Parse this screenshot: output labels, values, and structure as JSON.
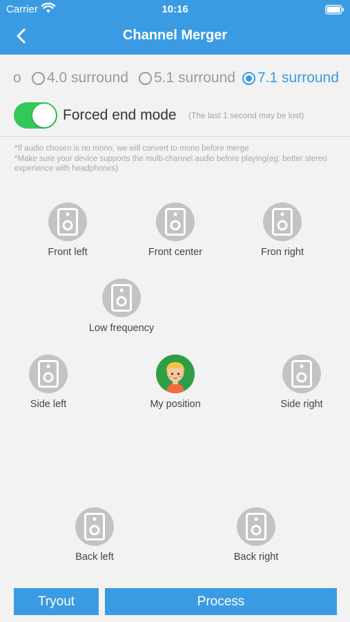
{
  "status_bar": {
    "carrier": "Carrier",
    "time": "10:16"
  },
  "nav": {
    "title": "Channel Merger"
  },
  "surround": {
    "clipped_label": "o",
    "options": [
      {
        "label": "4.0 surround",
        "selected": false
      },
      {
        "label": "5.1 surround",
        "selected": false
      },
      {
        "label": "7.1 surround",
        "selected": true
      }
    ]
  },
  "forced_end": {
    "label": "Forced end mode",
    "note": "(The last 1 second may be lost)",
    "enabled": true
  },
  "notes": {
    "line1": "*If audio chosen is no mono, we will convert to mono before merge",
    "line2": "*Make sure your device supports the multi-channel audio before playing(eg: better stereo experience with headphones)"
  },
  "speakers": {
    "front_left": "Front left",
    "front_center": "Front center",
    "front_right": "Fron right",
    "low_frequency": "Low frequency",
    "side_left": "Side left",
    "my_position": "My position",
    "side_right": "Side right",
    "back_left": "Back left",
    "back_right": "Back right"
  },
  "buttons": {
    "tryout": "Tryout",
    "process": "Process"
  },
  "colors": {
    "accent": "#3a9be3",
    "toggle_on": "#34c759",
    "speaker_disc": "#c3c3c3",
    "avatar_bg": "#2f9e44"
  }
}
